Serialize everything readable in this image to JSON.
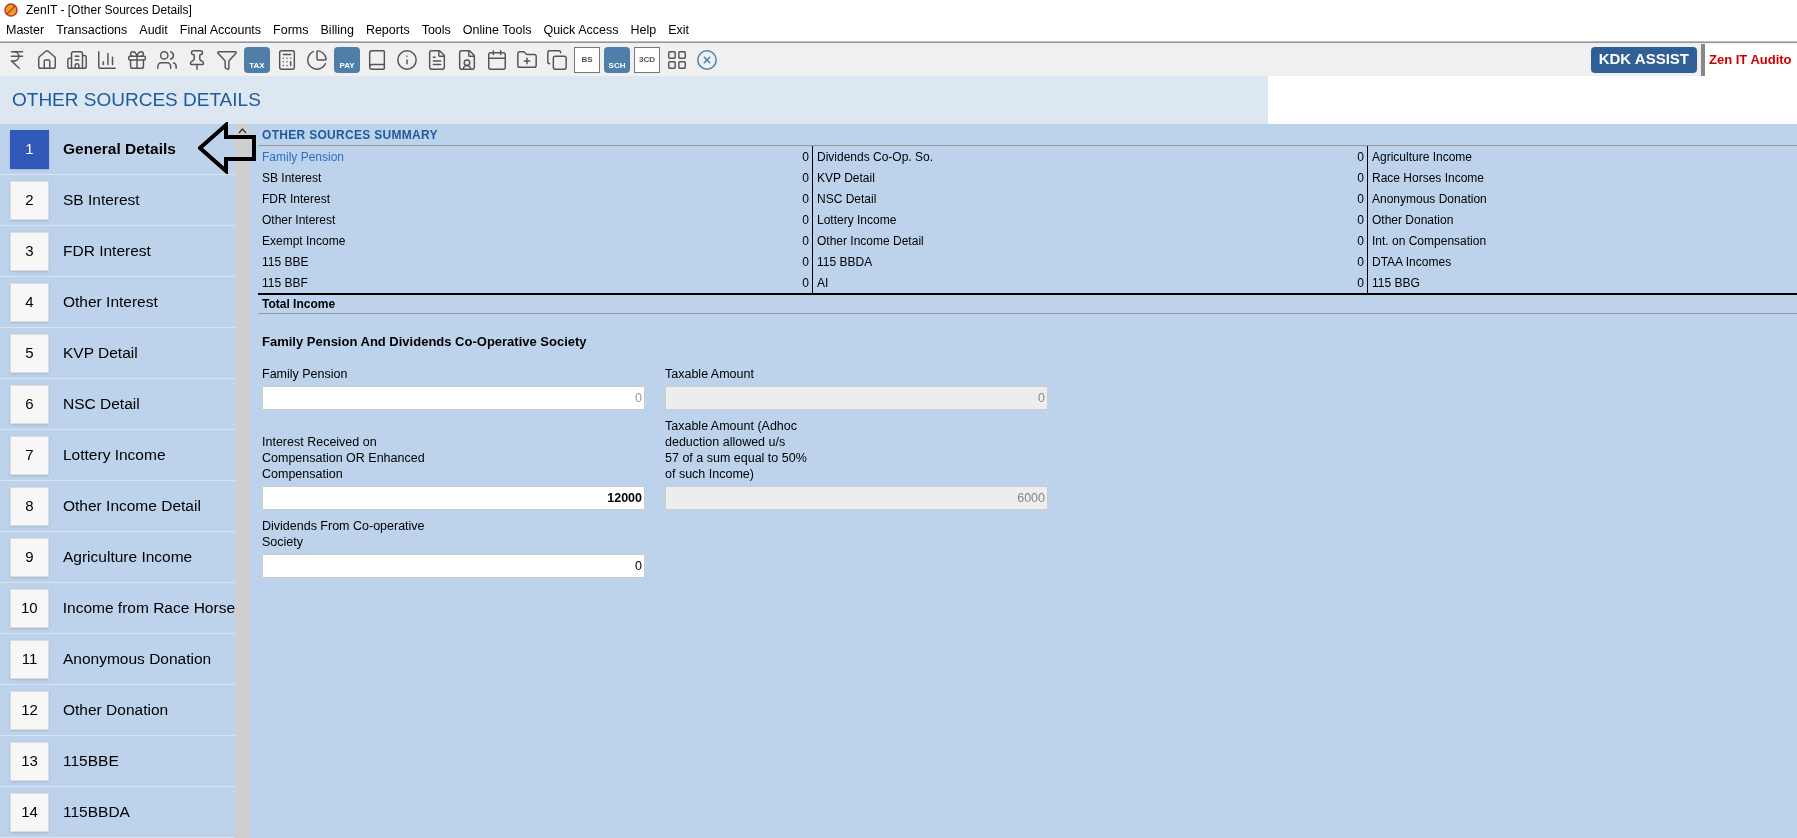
{
  "window": {
    "title": "ZenIT - [Other Sources Details]"
  },
  "menu": [
    "Master",
    "Transactions",
    "Audit",
    "Final Accounts",
    "Forms",
    "Billing",
    "Reports",
    "Tools",
    "Online Tools",
    "Quick Access",
    "Help",
    "Exit"
  ],
  "toolbar": [
    {
      "kind": "rupee"
    },
    {
      "kind": "home"
    },
    {
      "kind": "building"
    },
    {
      "kind": "chart"
    },
    {
      "kind": "gift"
    },
    {
      "kind": "users"
    },
    {
      "kind": "pin"
    },
    {
      "kind": "filter"
    },
    {
      "kind": "tag",
      "label": "TAX"
    },
    {
      "kind": "calculator"
    },
    {
      "kind": "pie"
    },
    {
      "kind": "tag",
      "label": "PAY"
    },
    {
      "kind": "book"
    },
    {
      "kind": "info"
    },
    {
      "kind": "report"
    },
    {
      "kind": "user-doc"
    },
    {
      "kind": "calendar"
    },
    {
      "kind": "folder"
    },
    {
      "kind": "copy"
    },
    {
      "kind": "doc",
      "label": "BS"
    },
    {
      "kind": "tag",
      "label": "SCH"
    },
    {
      "kind": "doc",
      "label": "3CD"
    },
    {
      "kind": "grid"
    },
    {
      "kind": "close"
    }
  ],
  "assist_button": "KDK ASSIST",
  "app_tab": "Zen IT Audito",
  "page_title": "OTHER SOURCES DETAILS",
  "sidebar": {
    "items": [
      {
        "number": "1",
        "label": "General Details",
        "selected": true
      },
      {
        "number": "2",
        "label": "SB Interest",
        "selected": false
      },
      {
        "number": "3",
        "label": "FDR Interest",
        "selected": false
      },
      {
        "number": "4",
        "label": "Other Interest",
        "selected": false
      },
      {
        "number": "5",
        "label": "KVP Detail",
        "selected": false
      },
      {
        "number": "6",
        "label": "NSC Detail",
        "selected": false
      },
      {
        "number": "7",
        "label": "Lottery Income",
        "selected": false
      },
      {
        "number": "8",
        "label": "Other Income Detail",
        "selected": false
      },
      {
        "number": "9",
        "label": "Agriculture Income",
        "selected": false
      },
      {
        "number": "10",
        "label": "Income from Race Horse",
        "selected": false
      },
      {
        "number": "11",
        "label": "Anonymous Donation",
        "selected": false
      },
      {
        "number": "12",
        "label": "Other Donation",
        "selected": false
      },
      {
        "number": "13",
        "label": "115BBE",
        "selected": false
      },
      {
        "number": "14",
        "label": "115BBDA",
        "selected": false
      }
    ]
  },
  "summary": {
    "title": "OTHER SOURCES SUMMARY",
    "rows": [
      [
        {
          "label": "Family Pension",
          "value": "0",
          "link": true
        },
        {
          "label": "Dividends Co-Op. So.",
          "value": "0"
        },
        {
          "label": "Agriculture Income"
        }
      ],
      [
        {
          "label": "SB Interest",
          "value": "0"
        },
        {
          "label": "KVP Detail",
          "value": "0"
        },
        {
          "label": "Race Horses Income"
        }
      ],
      [
        {
          "label": "FDR Interest",
          "value": "0"
        },
        {
          "label": "NSC Detail",
          "value": "0"
        },
        {
          "label": "Anonymous Donation"
        }
      ],
      [
        {
          "label": "Other Interest",
          "value": "0"
        },
        {
          "label": "Lottery Income",
          "value": "0"
        },
        {
          "label": "Other Donation"
        }
      ],
      [
        {
          "label": "Exempt Income",
          "value": "0"
        },
        {
          "label": "Other Income Detail",
          "value": "0"
        },
        {
          "label": "Int. on Compensation"
        }
      ],
      [
        {
          "label": "115 BBE",
          "value": "0"
        },
        {
          "label": "115 BBDA",
          "value": "0"
        },
        {
          "label": "DTAA Incomes"
        }
      ],
      [
        {
          "label": "115 BBF",
          "value": "0"
        },
        {
          "label": "AI",
          "value": "0"
        },
        {
          "label": "115 BBG"
        }
      ]
    ],
    "total_label": "Total Income"
  },
  "form": {
    "title": "Family Pension And Dividends Co-Operative Society",
    "rows": [
      [
        {
          "label": "Family Pension",
          "value": "0",
          "disabled": false,
          "bold": false,
          "muted": true
        },
        {
          "label": "Taxable Amount",
          "value": "0",
          "disabled": true,
          "bold": false
        }
      ],
      [
        {
          "label": "Interest Received on\nCompensation OR Enhanced\nCompensation",
          "value": "12000",
          "disabled": false,
          "bold": true
        },
        {
          "label": "Taxable Amount (Adhoc\ndeduction allowed u/s\n57 of a sum equal to 50%\nof such Income)",
          "value": "6000",
          "disabled": true,
          "bold": false
        }
      ],
      [
        {
          "label": "Dividends From Co-operative\nSociety",
          "value": "0",
          "disabled": false,
          "bold": false
        }
      ]
    ]
  }
}
